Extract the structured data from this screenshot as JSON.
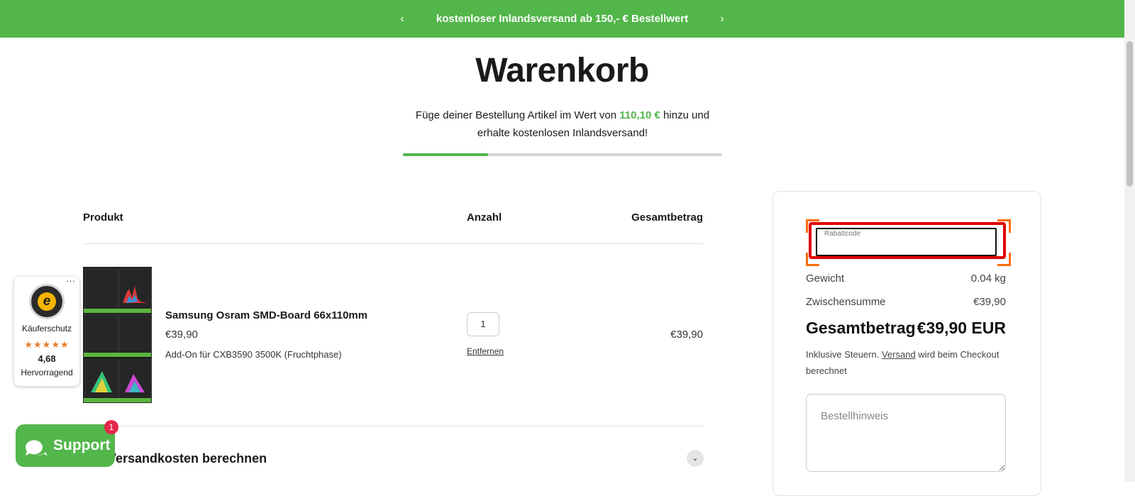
{
  "announcement": {
    "message": "kostenloser Inlandsversand ab 150,- € Bestellwert",
    "prev_icon": "chevron-left-icon",
    "next_icon": "chevron-right-icon"
  },
  "page_title": "Warenkorb",
  "shipping_progress": {
    "text_before": "Füge deiner Bestellung Artikel im Wert von",
    "amount": "110,10 €",
    "text_after": "hinzu und erhalte kostenlosen Inlandsversand!",
    "progress_fraction": 0.266,
    "color": "#52b64a"
  },
  "table": {
    "col_product": "Produkt",
    "col_quantity": "Anzahl",
    "col_total": "Gesamtbetrag"
  },
  "cart_items": [
    {
      "name": "Samsung Osram SMD-Board 66x110mm",
      "price": "€39,90",
      "variant": "Add-On für CXB3590 3500K (Fruchtphase)",
      "quantity": "1",
      "remove_label": "Entfernen",
      "line_total": "€39,90"
    }
  ],
  "shipping_calculator": {
    "label": "Versandkosten berechnen",
    "icon": "chevron-down-icon"
  },
  "trusted_shops": {
    "seal_letter": "e",
    "label": "Käuferschutz",
    "stars": "★★★★★",
    "score": "4,68",
    "rating_text": "Hervorragend"
  },
  "support": {
    "label": "Support",
    "badge_count": "1",
    "icon": "chat-icon"
  },
  "summary": {
    "coupon_label": "Rabattcode",
    "weight_label": "Gewicht",
    "weight_value": "0.04 kg",
    "subtotal_label": "Zwischensumme",
    "subtotal_value": "€39,90",
    "total_label": "Gesamtbetrag",
    "total_value": "€39,90 EUR",
    "tax_note_before": "Inklusive Steuern.",
    "tax_note_link": "Versand",
    "tax_note_after": "wird beim Checkout berechnet",
    "order_note_placeholder": "Bestellhinweis"
  },
  "colors": {
    "brand_green": "#52b64a",
    "highlight_red": "#e00000",
    "badge_red": "#e4264b",
    "stars_orange": "#e87d29"
  }
}
